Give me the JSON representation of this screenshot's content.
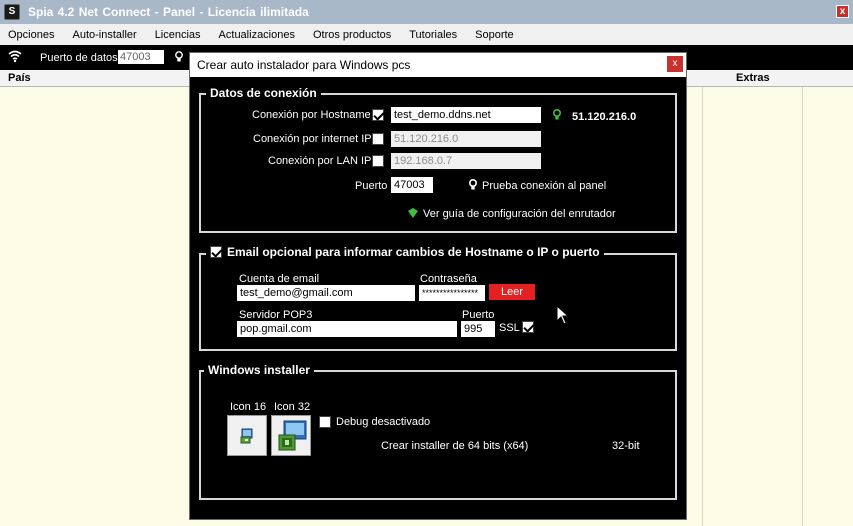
{
  "window": {
    "title": "Spia 4.2 Net Connect   -   Panel   -   Licencia ilimitada",
    "close_glyph": "x",
    "app_icon": "spia-logo-icon",
    "app_icon_glyph": "S"
  },
  "menu": {
    "items": [
      "Opciones",
      "Auto-installer",
      "Licencias",
      "Actualizaciones",
      "Otros productos",
      "Tutoriales",
      "Soporte"
    ]
  },
  "toolbar": {
    "port_label": "Puerto de datos:",
    "port_value": "47003",
    "wifi_icon": "wifi-icon",
    "bulb_icon": "lightbulb-icon"
  },
  "table": {
    "columns": [
      "País",
      "Extras"
    ]
  },
  "dialog": {
    "title": "Crear auto instalador para Windows pcs",
    "close_glyph": "x",
    "conexion": {
      "legend": "Datos de conexión",
      "hostname_label": "Conexión por Hostname",
      "hostname_checked": true,
      "hostname_value": "test_demo.ddns.net",
      "hostname_ip": "51.120.216.0",
      "internet_label": "Conexión por internet IP",
      "internet_checked": false,
      "internet_value": "51.120.216.0",
      "lan_label": "Conexión por LAN IP",
      "lan_checked": false,
      "lan_value": "192.168.0.7",
      "port_label": "Puerto",
      "port_value": "47003",
      "test_label": "Prueba conexión al panel",
      "guide_label": "Ver guía de configuración del enrutador",
      "colors": {
        "green": "#3fbf3f"
      }
    },
    "email": {
      "legend": "Email opcional para informar cambios de Hostname o IP o puerto",
      "enabled": true,
      "account_label": "Cuenta de email",
      "account_value": "test_demo@gmail.com",
      "password_label": "Contraseña",
      "password_value": "****************",
      "read_button": "Leer",
      "pop3_label": "Servidor POP3",
      "pop3_value": "pop.gmail.com",
      "port_label": "Puerto",
      "port_value": "995",
      "ssl_label": "SSL",
      "ssl_checked": true,
      "read_button_color": "#e42020"
    },
    "installer": {
      "legend": "Windows installer",
      "icon16_label": "Icon 16",
      "icon32_label": "Icon 32",
      "debug_label": "Debug desactivado",
      "debug_checked": false,
      "create_64_label": "Crear installer de 64 bits  (x64)",
      "bits_label": "32-bit"
    }
  }
}
